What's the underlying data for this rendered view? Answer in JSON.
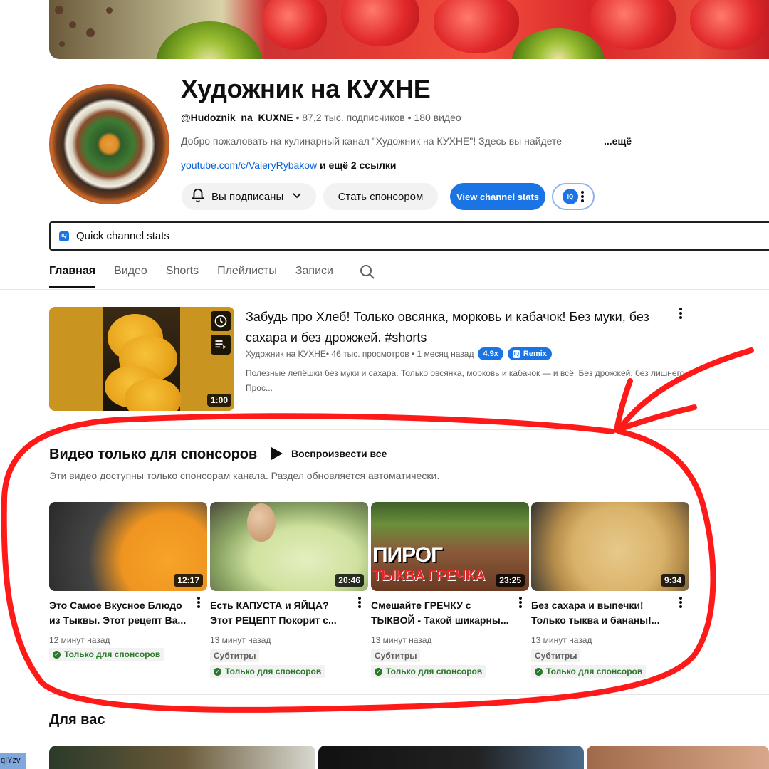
{
  "channel": {
    "title": "Художник на КУХНЕ",
    "handle": "@Hudoznik_na_KUXNE",
    "meta": " • 87,2 тыс. подписчиков • 180 видео",
    "description": "Добро пожаловать на кулинарный канал \"Художник на КУХНЕ\"!  Здесь вы найдете",
    "more": "...ещё",
    "link": "youtube.com/c/ValeryRybakow",
    "link_suffix": " и ещё 2 ссылки"
  },
  "buttons": {
    "subscribed": "Вы подписаны",
    "sponsor": "Стать спонсором",
    "stats": "View channel stats",
    "iq": "IQ"
  },
  "quick_stats": {
    "icon": "IQ",
    "label": "Quick channel stats"
  },
  "tabs": [
    "Главная",
    "Видео",
    "Shorts",
    "Плейлисты",
    "Записи"
  ],
  "featured": {
    "title": "Забудь про Хлеб! Только овсянка, морковь и кабачок! Без муки, без сахара и без дрожжей. #shorts",
    "channel": "Художник на КУХНЕ",
    "stats": " • 46 тыс. просмотров • 1 месяц назад",
    "badge_ratio": "4.9x",
    "badge_remix": "Remix",
    "badge_remix_icon": "IQ",
    "description": "Полезные лепёшки без муки и сахара. Только овсянка, морковь и кабачок — и всё. Без дрожжей, без лишнего. Прос...",
    "duration": "1:00"
  },
  "sponsor_section": {
    "title": "Видео только для спонсоров",
    "play_all": "Воспроизвести все",
    "subtitle": "Эти видео доступны только спонсорам канала. Раздел обновляется автоматически.",
    "videos": [
      {
        "title": "Это Самое Вкусное Блюдо из Тыквы. Этот рецепт Ва...",
        "duration": "12:17",
        "time": "12 минут назад",
        "subtitles": "",
        "badge": "Только для спонсоров"
      },
      {
        "title": "Есть КАПУСТА и ЯЙЦА? Этот РЕЦЕПТ Покорит с...",
        "duration": "20:46",
        "time": "13 минут назад",
        "subtitles": "Субтитры",
        "badge": "Только для спонсоров"
      },
      {
        "title": "Смешайте ГРЕЧКУ с ТЫКВОЙ - Такой шикарны...",
        "duration": "23:25",
        "time": "13 минут назад",
        "subtitles": "Субтитры",
        "badge": "Только для спонсоров",
        "overlay_1": "ПИРОГ",
        "overlay_2": "ТЫКВА ГРЕЧКА"
      },
      {
        "title": "Без сахара и выпечки! Только тыква и бананы!...",
        "duration": "9:34",
        "time": "13 минут назад",
        "subtitles": "Субтитры",
        "badge": "Только для спонсоров"
      }
    ]
  },
  "for_you": {
    "title": "Для вас"
  },
  "corner_text": "qIYzv",
  "colors": {
    "accent": "#1b74e4",
    "link": "#065fd4",
    "annotation": "#ff1a1a",
    "sponsor_green": "#2b7a2b"
  },
  "icons": [
    "bell-icon",
    "chevron-down-icon",
    "search-icon",
    "clock-icon",
    "playlist-add-icon",
    "play-icon",
    "more-vert-icon",
    "check-circle-icon"
  ]
}
